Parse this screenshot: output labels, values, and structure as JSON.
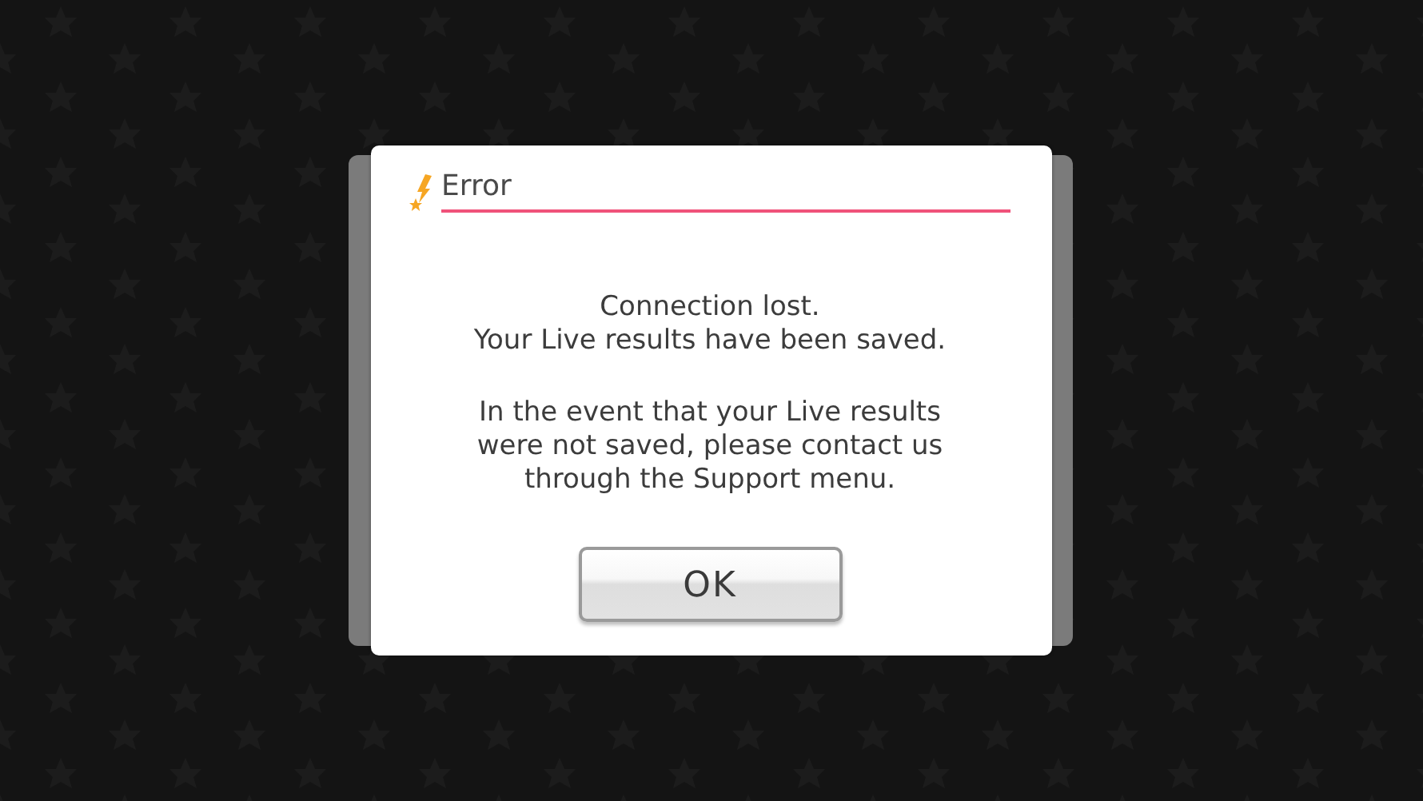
{
  "dialog": {
    "title": "Error",
    "paragraphs": [
      "Connection lost.\nYour Live results have been saved.",
      "In the event that your Live results\nwere not saved, please contact us\nthrough the Support menu."
    ],
    "buttons": [
      "OK"
    ]
  }
}
